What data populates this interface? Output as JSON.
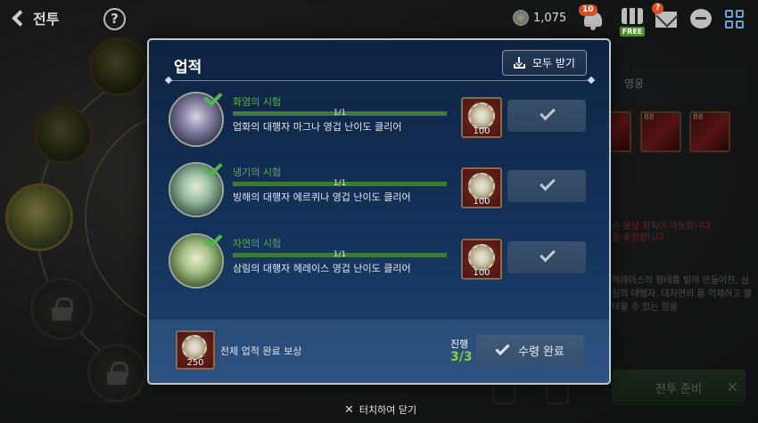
{
  "topbar": {
    "back_label": "전투",
    "help_glyph": "?",
    "currency_value": "1,075",
    "notification_badge": "10",
    "mail_badge": "?",
    "free_tag": "FREE"
  },
  "background": {
    "tab_label": "영웅",
    "item_counts": [
      "88",
      "88"
    ],
    "red_notice": [
      "큰 보상 획득이 가능합니다.",
      "을 추천합니다."
    ],
    "description": "헤레이스의 형태를 빌려 만들어진, 삼림의 대행자. 대자연의 을 억제하고 불태울 수 있는 힘을",
    "ready_button": "전투 준비"
  },
  "modal": {
    "title": "업적",
    "claim_all_label": "모두 받기",
    "achievements": [
      {
        "name": "화염의 시험",
        "progress_text": "1/1",
        "progress": 1.0,
        "description": "업화의 대행자 마그나 영겁 난이도 클리어",
        "reward_qty": "100",
        "portrait_color": "#6c6a88"
      },
      {
        "name": "냉기의 시험",
        "progress_text": "1/1",
        "progress": 1.0,
        "description": "빙해의 대행자 에르퀴나 영겁 난이도 클리어",
        "reward_qty": "100",
        "portrait_color": "#7fa88a"
      },
      {
        "name": "자연의 시험",
        "progress_text": "1/1",
        "progress": 1.0,
        "description": "삼림의 대행자 헤레이스 영겁 난이도 클리어",
        "reward_qty": "100",
        "portrait_color": "#8aa870"
      }
    ],
    "footer": {
      "total_label": "전체 업적 완료 보상",
      "total_reward_qty": "250",
      "progress_label": "진행",
      "progress_count": "3/3",
      "received_label": "수령 완료"
    }
  },
  "close_hint": "터치하여 닫기",
  "colors": {
    "accent_green": "#58b243",
    "progress_green": "#8ccc3a",
    "modal_bg": "#14325a"
  }
}
